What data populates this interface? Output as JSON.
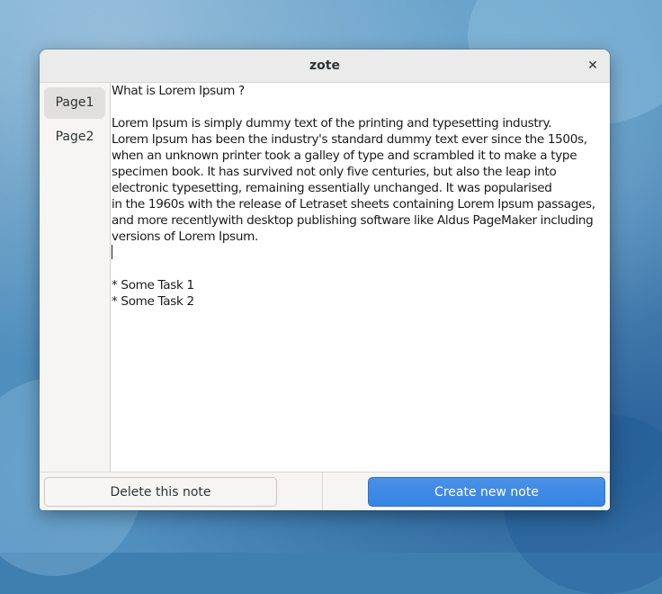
{
  "window": {
    "title": "zote",
    "close_symbol": "✕"
  },
  "sidebar": {
    "pages": [
      {
        "label": "Page1",
        "selected": true
      },
      {
        "label": "Page2",
        "selected": false
      }
    ]
  },
  "editor": {
    "heading": "What is Lorem Ipsum ?",
    "paragraph_lines": [
      "Lorem Ipsum is simply dummy text of the printing and typesetting industry.",
      "Lorem Ipsum has been the industry's standard dummy text ever since the 1500s,",
      "when an unknown printer took a galley of type and scrambled it to make a type",
      "specimen book. It has survived not only five centuries, but also the leap into",
      "electronic typesetting, remaining essentially unchanged. It was popularised",
      "in the 1960s with the release of Letraset sheets containing Lorem Ipsum passages,",
      "and more recentlywith desktop publishing software like Aldus PageMaker including",
      "versions of Lorem Ipsum."
    ],
    "tasks": [
      "* Some Task 1",
      "* Some Task 2"
    ]
  },
  "actions": {
    "delete_label": "Delete this note",
    "create_label": "Create new note"
  },
  "colors": {
    "accent": "#3584e4",
    "sidebar_bg": "#f6f5f4",
    "selected_tab_bg": "#e1e0de"
  }
}
